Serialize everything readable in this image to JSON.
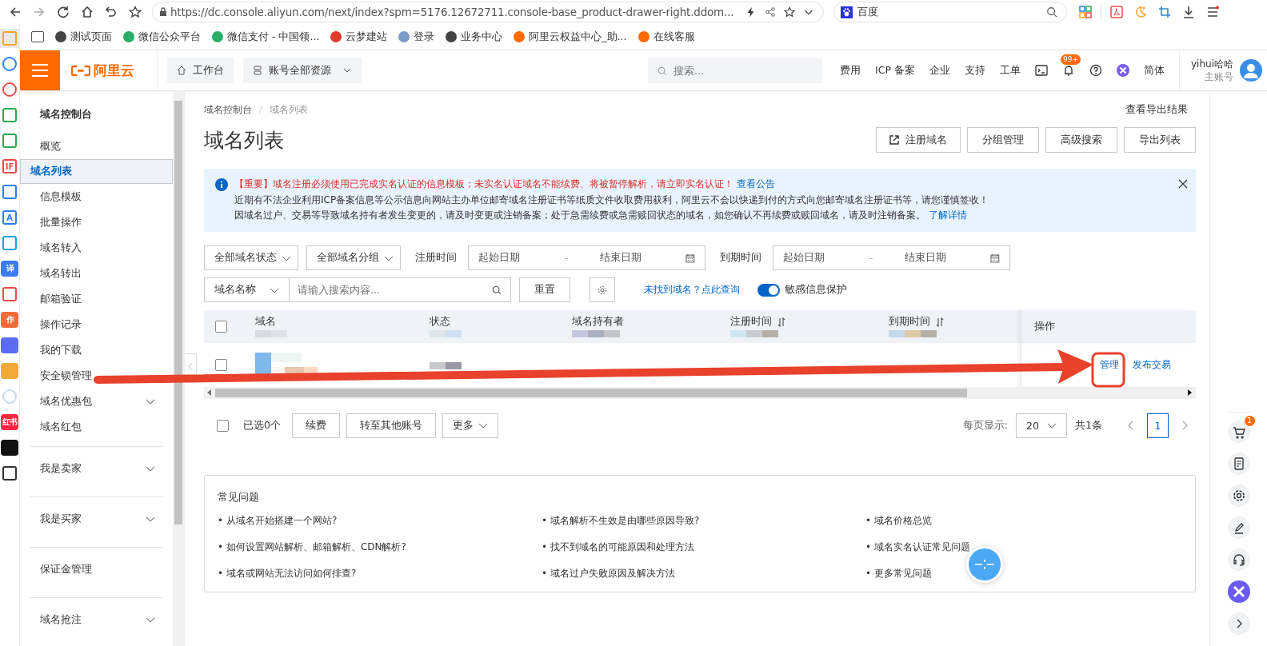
{
  "browser": {
    "url": "https://dc.console.aliyun.com/next/index?spm=5176.12672711.console-base_product-drawer-right.ddom...",
    "search_engine": "百度",
    "bookmarks": [
      {
        "kind": "panel"
      },
      {
        "kind": "globe",
        "label": "测试页面"
      },
      {
        "kind": "wechat",
        "label": "微信公众平台"
      },
      {
        "kind": "wepay",
        "label": "微信支付 - 中国领..."
      },
      {
        "kind": "diamond",
        "label": "云梦建站"
      },
      {
        "kind": "page",
        "label": "登录"
      },
      {
        "kind": "globe",
        "label": "业务中心"
      },
      {
        "kind": "aliyun",
        "label": "阿里云权益中心_助..."
      },
      {
        "kind": "aliyun",
        "label": "在线客服"
      }
    ]
  },
  "left_strip": [
    {
      "kind": "star",
      "selected": true
    },
    {
      "kind": "clock",
      "selected": false
    },
    {
      "kind": "record",
      "selected": false
    },
    {
      "kind": "qr",
      "selected": false
    },
    {
      "kind": "doc",
      "selected": false
    },
    {
      "kind": "gif",
      "text": "IF",
      "selected": false
    },
    {
      "kind": "crop",
      "selected": false
    },
    {
      "kind": "scan",
      "text": "A",
      "selected": false
    },
    {
      "kind": "monitor",
      "selected": false
    },
    {
      "kind": "translate",
      "text": "译",
      "selected": false
    },
    {
      "kind": "pdf",
      "selected": false
    },
    {
      "kind": "write",
      "text": "作",
      "selected": false
    },
    {
      "kind": "ds",
      "selected": false
    },
    {
      "kind": "game",
      "selected": false
    },
    {
      "kind": "avatar",
      "selected": false
    },
    {
      "kind": "redbook",
      "text": "红书",
      "selected": false
    },
    {
      "kind": "k",
      "selected": false
    },
    {
      "kind": "plus",
      "selected": false
    }
  ],
  "header": {
    "logo": "阿里云",
    "workbench": "工作台",
    "resources": "账号全部资源",
    "search_placeholder": "搜索...",
    "nav": [
      "费用",
      "ICP 备案",
      "企业",
      "支持",
      "工单"
    ],
    "bell_badge": "99+",
    "language": "简体",
    "user": "yihui哈哈",
    "account_type": "主账号"
  },
  "sidebar": {
    "title": "域名控制台",
    "sections": [
      {
        "items": [
          {
            "label": "概览",
            "kind": "link",
            "selected": false
          },
          {
            "label": "域名列表",
            "kind": "link",
            "selected": true
          },
          {
            "label": "信息模板",
            "kind": "link",
            "selected": false
          },
          {
            "label": "批量操作",
            "kind": "link",
            "selected": false
          },
          {
            "label": "域名转入",
            "kind": "link",
            "selected": false
          },
          {
            "label": "域名转出",
            "kind": "link",
            "selected": false
          },
          {
            "label": "邮箱验证",
            "kind": "link",
            "selected": false
          },
          {
            "label": "操作记录",
            "kind": "link",
            "selected": false
          },
          {
            "label": "我的下载",
            "kind": "link",
            "selected": false
          },
          {
            "label": "安全锁管理",
            "kind": "link",
            "selected": false
          },
          {
            "label": "域名优惠包",
            "kind": "group",
            "selected": false
          },
          {
            "label": "域名红包",
            "kind": "link",
            "selected": false
          }
        ]
      },
      {
        "items": [
          {
            "label": "我是卖家",
            "kind": "group",
            "selected": false
          }
        ]
      },
      {
        "items": [
          {
            "label": "我是买家",
            "kind": "group",
            "selected": false
          }
        ]
      },
      {
        "items": [
          {
            "label": "保证金管理",
            "kind": "link",
            "selected": false
          }
        ]
      },
      {
        "items": [
          {
            "label": "域名抢注",
            "kind": "group",
            "selected": false
          }
        ]
      }
    ]
  },
  "breadcrumb": [
    "域名控制台",
    "域名列表"
  ],
  "export_results": "查看导出结果",
  "title": "域名列表",
  "actions": [
    {
      "label": "注册域名",
      "kind": "external"
    },
    {
      "label": "分组管理",
      "kind": "plain"
    },
    {
      "label": "高级搜索",
      "kind": "plain"
    },
    {
      "label": "导出列表",
      "kind": "plain"
    }
  ],
  "alert": {
    "lines": [
      {
        "important": true,
        "text": "【重要】域名注册必须使用已完成实名认证的信息模板；未实名认证域名不能续费、将被暂停解析，请立即实名认证！",
        "link": "查看公告"
      },
      {
        "important": false,
        "text": "近期有不法企业利用ICP备案信息等公示信息向网站主办单位邮寄域名注册证书等纸质文件收取费用获利，阿里云不会以快递到付的方式向您邮寄域名注册证书等，请您谨慎签收！"
      },
      {
        "important": false,
        "text": "因域名过户、交易等导致域名持有者发生变更的，请及时变更或注销备案；处于急需续费或急需赎回状态的域名，如您确认不再续费或赎回域名，请及时注销备案。",
        "link": "了解详情"
      }
    ]
  },
  "filters": {
    "status": "全部域名状态",
    "group": "全部域名分组",
    "reg_label": "注册时间",
    "reg_start": "起始日期",
    "reg_sep": "-",
    "reg_end": "结束日期",
    "exp_label": "到期时间",
    "exp_start": "起始日期",
    "exp_sep": "-",
    "exp_end": "结束日期",
    "field": "域名名称",
    "search_placeholder": "请输入搜索内容...",
    "reset": "重置",
    "not_found_link": "未找到域名？点此查询",
    "privacy": {
      "label": "敏感信息保护",
      "on": true
    }
  },
  "table": {
    "all_checked": false,
    "columns": [
      {
        "label": "域名",
        "sortable": false
      },
      {
        "label": "状态",
        "sortable": false
      },
      {
        "label": "域名持有者",
        "sortable": false
      },
      {
        "label": "注册时间",
        "sortable": true
      },
      {
        "label": "到期时间",
        "sortable": true
      },
      {
        "label": "操作",
        "sortable": false
      }
    ],
    "rows": [
      {
        "checked": false,
        "actions": [
          "管理",
          "发布交易"
        ]
      }
    ]
  },
  "footer": {
    "checked": false,
    "selected_count": "已选0个",
    "buttons": [
      "续费",
      "转至其他账号"
    ],
    "more": "更多",
    "page_size_label": "每页显示:",
    "page_size": "20",
    "total": "共1条",
    "pages": [
      {
        "label": "1",
        "selected": true
      }
    ]
  },
  "faq": {
    "title": "常见问题",
    "items": [
      "• 从域名开始搭建一个网站?",
      "• 域名解析不生效是由哪些原因导致?",
      "• 域名价格总览",
      "• 如何设置网站解析、邮箱解析、CDN解析?",
      "• 找不到域名的可能原因和处理方法",
      "• 域名实名认证常见问题",
      "• 域名或网站无法访问如何排查?",
      "• 域名过户失败原因及解决方法",
      "• 更多常见问题"
    ]
  },
  "right_bar": {
    "cart_badge": "1"
  }
}
